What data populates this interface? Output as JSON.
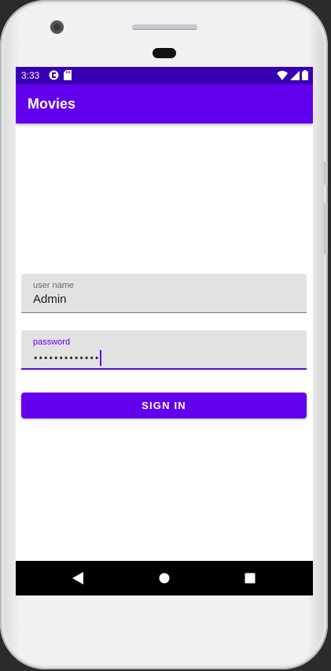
{
  "status_bar": {
    "time": "3:33",
    "left_icons": [
      "notification-app-icon",
      "sd-card-icon"
    ],
    "right_icons": [
      "wifi-icon",
      "cell-signal-icon",
      "battery-icon"
    ]
  },
  "app_bar": {
    "title": "Movies"
  },
  "form": {
    "username": {
      "label": "user name",
      "value": "Admin"
    },
    "password": {
      "label": "password",
      "value": "•••••••••••••"
    },
    "signin_label": "SIGN IN"
  },
  "nav_bar": {
    "buttons": [
      "back-icon",
      "home-icon",
      "recents-icon"
    ]
  },
  "colors": {
    "status_bar": "#3700b3",
    "primary": "#6200ee",
    "field_bg": "#e2e2e2",
    "nav_bar": "#000000"
  }
}
